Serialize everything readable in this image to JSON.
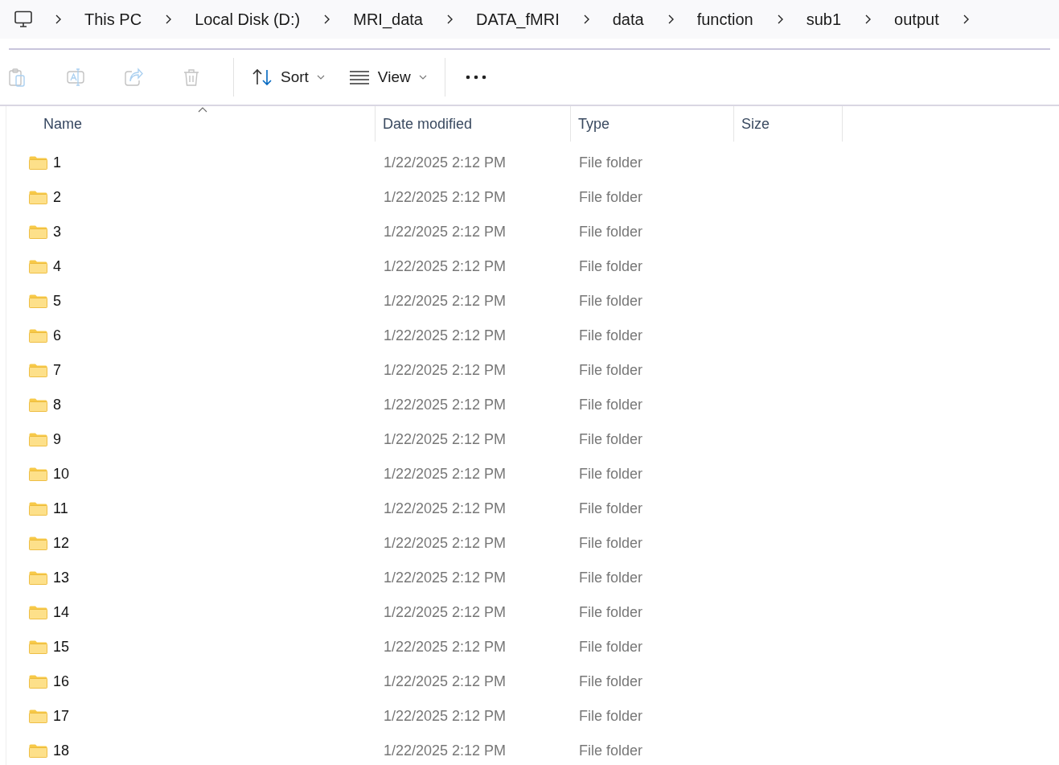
{
  "breadcrumb": [
    {
      "label": "This PC"
    },
    {
      "label": "Local Disk (D:)"
    },
    {
      "label": "MRI_data"
    },
    {
      "label": "DATA_fMRI"
    },
    {
      "label": "data"
    },
    {
      "label": "function"
    },
    {
      "label": "sub1"
    },
    {
      "label": "output"
    }
  ],
  "toolbar": [
    {
      "kind": "paste",
      "disabled": true
    },
    {
      "kind": "rename",
      "disabled": true
    },
    {
      "kind": "share",
      "disabled": true
    },
    {
      "kind": "delete",
      "disabled": true
    },
    {
      "kind": "separator"
    },
    {
      "kind": "sort",
      "label": "Sort"
    },
    {
      "kind": "view",
      "label": "View"
    },
    {
      "kind": "separator"
    },
    {
      "kind": "more"
    }
  ],
  "columns": [
    {
      "label": "Name",
      "sorted": true
    },
    {
      "label": "Date modified",
      "sorted": false
    },
    {
      "label": "Type",
      "sorted": false
    },
    {
      "label": "Size",
      "sorted": false
    }
  ],
  "rows": [
    {
      "name": "1",
      "date": "1/22/2025 2:12 PM",
      "type": "File folder"
    },
    {
      "name": "2",
      "date": "1/22/2025 2:12 PM",
      "type": "File folder"
    },
    {
      "name": "3",
      "date": "1/22/2025 2:12 PM",
      "type": "File folder"
    },
    {
      "name": "4",
      "date": "1/22/2025 2:12 PM",
      "type": "File folder"
    },
    {
      "name": "5",
      "date": "1/22/2025 2:12 PM",
      "type": "File folder"
    },
    {
      "name": "6",
      "date": "1/22/2025 2:12 PM",
      "type": "File folder"
    },
    {
      "name": "7",
      "date": "1/22/2025 2:12 PM",
      "type": "File folder"
    },
    {
      "name": "8",
      "date": "1/22/2025 2:12 PM",
      "type": "File folder"
    },
    {
      "name": "9",
      "date": "1/22/2025 2:12 PM",
      "type": "File folder"
    },
    {
      "name": "10",
      "date": "1/22/2025 2:12 PM",
      "type": "File folder"
    },
    {
      "name": "11",
      "date": "1/22/2025 2:12 PM",
      "type": "File folder"
    },
    {
      "name": "12",
      "date": "1/22/2025 2:12 PM",
      "type": "File folder"
    },
    {
      "name": "13",
      "date": "1/22/2025 2:12 PM",
      "type": "File folder"
    },
    {
      "name": "14",
      "date": "1/22/2025 2:12 PM",
      "type": "File folder"
    },
    {
      "name": "15",
      "date": "1/22/2025 2:12 PM",
      "type": "File folder"
    },
    {
      "name": "16",
      "date": "1/22/2025 2:12 PM",
      "type": "File folder"
    },
    {
      "name": "17",
      "date": "1/22/2025 2:12 PM",
      "type": "File folder"
    },
    {
      "name": "18",
      "date": "1/22/2025 2:12 PM",
      "type": "File folder"
    }
  ]
}
